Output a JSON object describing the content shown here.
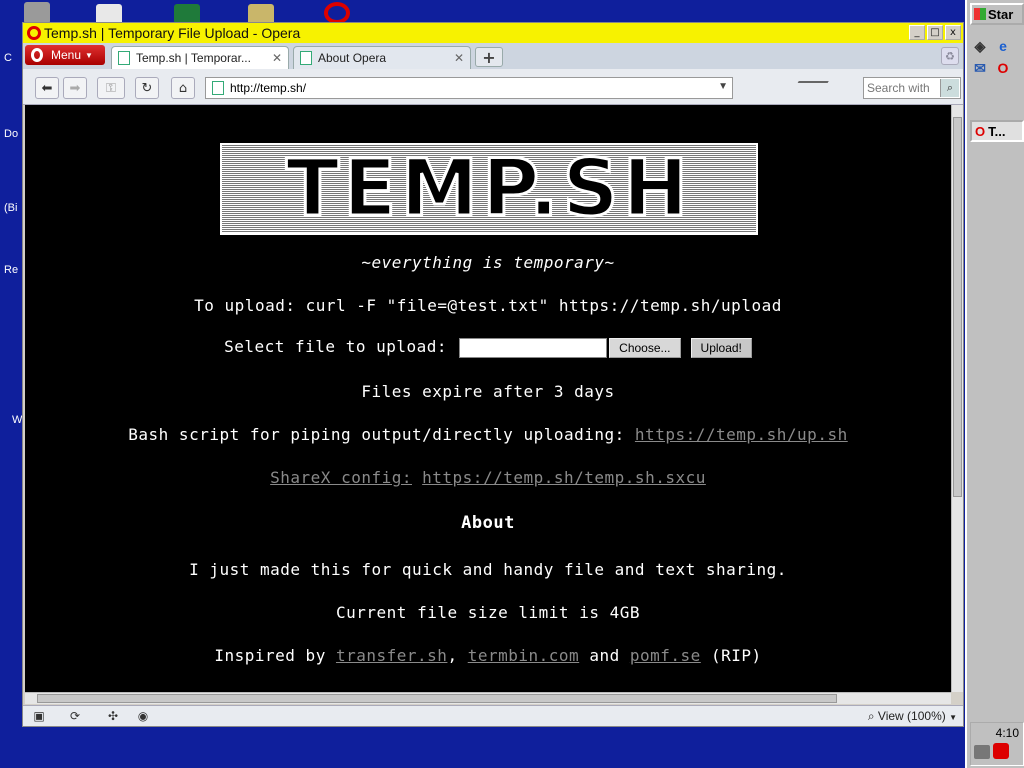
{
  "desktop": {
    "labels": [
      "C",
      "Do",
      "(Bi",
      "Re",
      "W"
    ]
  },
  "window": {
    "title": "Temp.sh | Temporary File Upload - Opera",
    "controls": {
      "minimize": "_",
      "maximize": "□",
      "close": "x"
    }
  },
  "menu": {
    "label": "Menu"
  },
  "tabs": [
    {
      "label": "Temp.sh | Temporar...",
      "active": true
    },
    {
      "label": "About Opera",
      "active": false
    }
  ],
  "toolbar": {
    "url": "http://temp.sh/",
    "search_placeholder": "Search with"
  },
  "page": {
    "logo_text": "TEMP.SH",
    "tagline": "~everything is temporary~",
    "upload_cmd": "To upload: curl -F \"file=@test.txt\" https://temp.sh/upload",
    "select_label": "Select file to upload:",
    "choose_label": "Choose...",
    "upload_label": "Upload!",
    "expire": "Files expire after 3 days",
    "bash_text": "Bash script for piping output/directly uploading:",
    "bash_link": "https://temp.sh/up.sh",
    "sharex_label": "ShareX config:",
    "sharex_link": "https://temp.sh/temp.sh.sxcu",
    "about_heading": "About",
    "about_text": "I just made this for quick and handy file and text sharing.",
    "limit": "Current file size limit is 4GB",
    "inspired_prefix": "Inspired by",
    "link_transfer": "transfer.sh",
    "comma": ",",
    "link_termbin": "termbin.com",
    "and_word": "and",
    "link_pomf": "pomf.se",
    "rip": "(RIP)"
  },
  "statusbar": {
    "zoom": "View (100%)"
  },
  "taskbar": {
    "start": "Star",
    "task": "T...",
    "clock": "4:10"
  }
}
